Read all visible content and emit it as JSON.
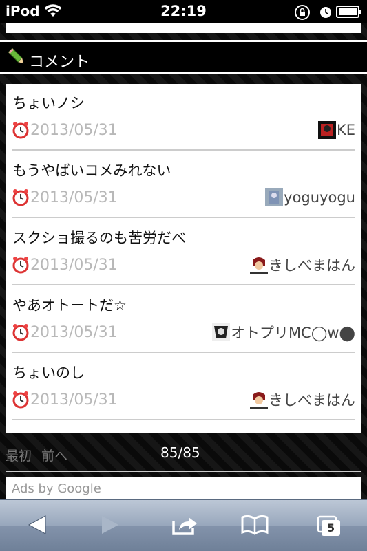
{
  "status_bar": {
    "carrier": "iPod",
    "time": "22:19"
  },
  "section": {
    "title": "コメント"
  },
  "comments": [
    {
      "text": "ちょいノシ",
      "date": "2013/05/31",
      "user": "KE"
    },
    {
      "text": "もうやばいコメみれない",
      "date": "2013/05/31",
      "user": "yoguyogu"
    },
    {
      "text": "スクショ撮るのも苦労だべ",
      "date": "2013/05/31",
      "user": "きしべまはん"
    },
    {
      "text": "やあオトートだ☆",
      "date": "2013/05/31",
      "user": "オトプリMC◯w⬤"
    },
    {
      "text": "ちょいのし",
      "date": "2013/05/31",
      "user": "きしべまはん"
    }
  ],
  "pager": {
    "first": "最初",
    "prev": "前へ",
    "count": "85/85"
  },
  "ads": {
    "label": "Ads by Google"
  },
  "toolbar": {
    "tabs_count": "5"
  },
  "colors": {
    "accent_date": "#b8b8b8",
    "toolbar_blue": "#8393ab"
  }
}
